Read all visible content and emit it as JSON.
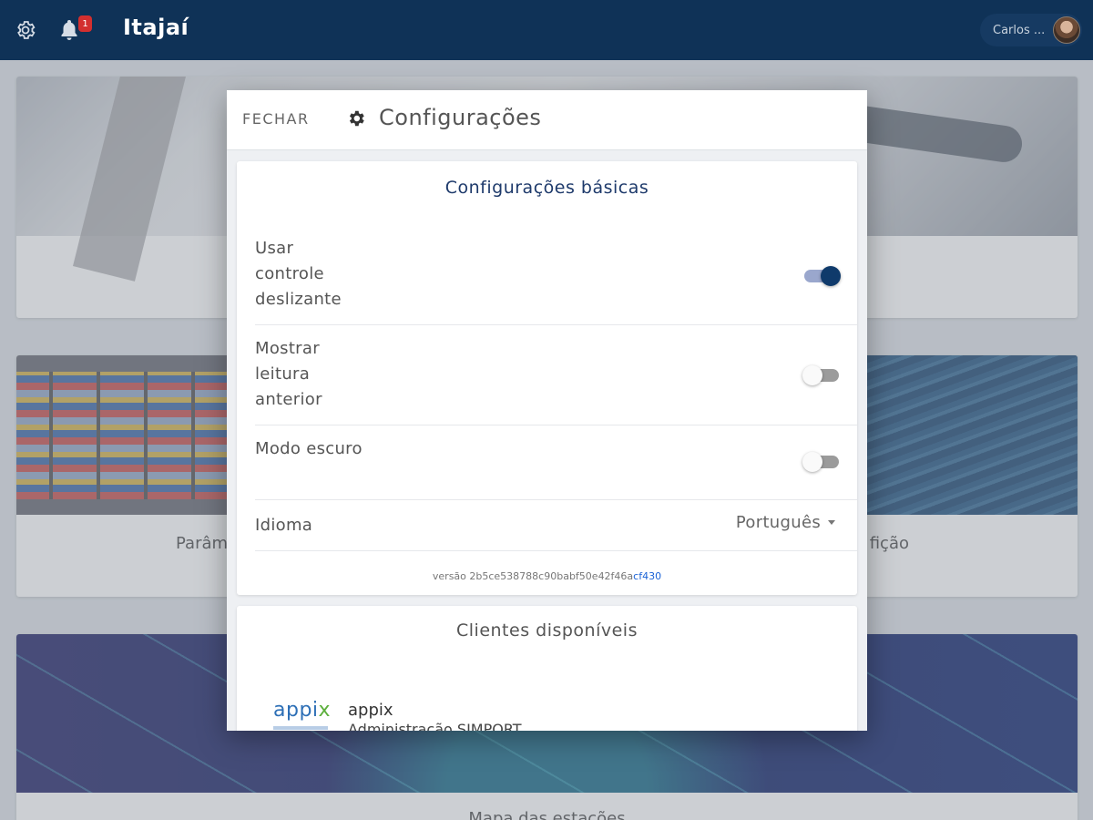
{
  "appbar": {
    "title": "Itajaí",
    "notification_count": "1",
    "user_name": "Carlos ..."
  },
  "background": {
    "card2_left_label": "Parâm",
    "card2_right_label": "fição",
    "card3_label": "Mapa das estações"
  },
  "dialog": {
    "close_label": "FECHAR",
    "title": "Configurações",
    "basic": {
      "title": "Configurações básicas",
      "settings": [
        {
          "label": "Usar controle deslizante",
          "enabled": true
        },
        {
          "label": "Mostrar leitura anterior",
          "enabled": false
        },
        {
          "label": "Modo escuro",
          "enabled": false
        }
      ],
      "language_label": "Idioma",
      "language_value": "Português",
      "version_prefix": "versão 2b5ce538788c90babf50e42f46a",
      "version_highlight": "cf430"
    },
    "clients": {
      "title": "Clientes disponíveis",
      "items": [
        {
          "logo_main": "appi",
          "logo_accent": "x",
          "name": "appix",
          "subtitle": "Administração SIMPORT"
        }
      ]
    }
  },
  "colors": {
    "appbar_bg": "#0f3257",
    "accent": "#0f3a6b",
    "badge": "#d32f2f",
    "link": "#1a62d6"
  },
  "icons": [
    "gear-icon",
    "bell-icon",
    "avatar",
    "settings-gear-icon",
    "dropdown-caret-icon"
  ]
}
